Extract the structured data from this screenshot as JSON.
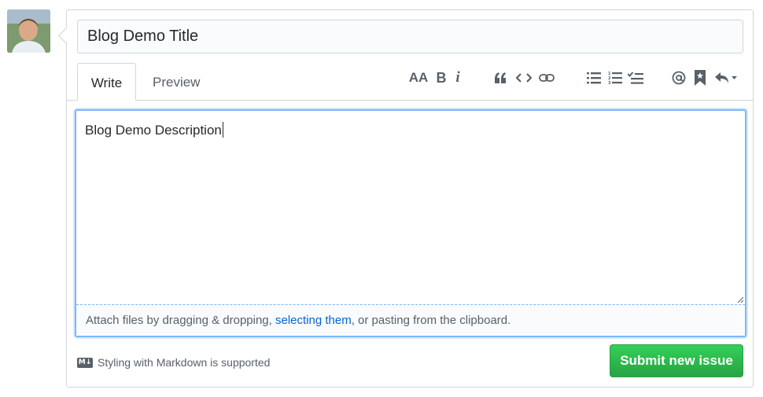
{
  "issue": {
    "title_value": "Blog Demo Title",
    "description_value": "Blog Demo Description"
  },
  "tabs": {
    "write": "Write",
    "preview": "Preview"
  },
  "toolbar": {
    "heading_label": "AA",
    "bold_label": "B",
    "italic_label": "i",
    "icons": [
      "text-size-icon",
      "bold-icon",
      "italic-icon",
      "quote-icon",
      "code-icon",
      "link-icon",
      "unordered-list-icon",
      "ordered-list-icon",
      "task-list-icon",
      "mention-icon",
      "saved-reply-icon",
      "reply-dropdown-icon"
    ]
  },
  "attach": {
    "before": "Attach files by dragging & dropping, ",
    "link": "selecting them",
    "after": ", or pasting from the clipboard."
  },
  "footer": {
    "markdown_badge": "M↓",
    "markdown_note": "Styling with Markdown is supported",
    "submit_label": "Submit new issue"
  },
  "colors": {
    "submit_green": "#28a745",
    "link_blue": "#0366d6",
    "focus_border": "#79b8ff"
  }
}
